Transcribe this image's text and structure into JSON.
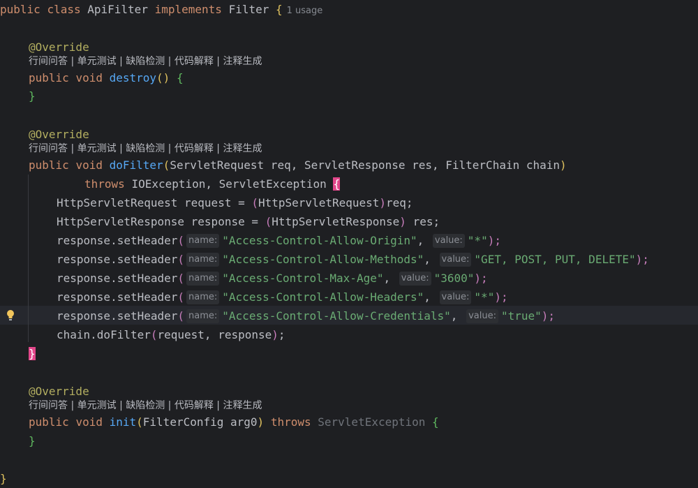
{
  "class_decl": {
    "kw1": "public",
    "kw2": "class",
    "name": "ApiFilter",
    "kw3": "implements",
    "iface": "Filter",
    "brace": "{",
    "usage": "1 usage"
  },
  "code_lens": "行间问答 | 单元测试 | 缺陷检测 | 代码解释 | 注释生成",
  "annotation": "@Override",
  "destroy": {
    "kw1": "public",
    "kw2": "void",
    "name": "destroy",
    "parens": "()",
    "open": "{",
    "close": "}"
  },
  "dofilter": {
    "kw1": "public",
    "kw2": "void",
    "name": "doFilter",
    "open_paren": "(",
    "params": "ServletRequest req, ServletResponse res, FilterChain chain",
    "close_paren": ")",
    "throws_kw": "throws",
    "exceptions": "IOException, ServletException",
    "open_brace": "{",
    "close_brace": "}"
  },
  "body": {
    "l1": {
      "type": "HttpServletRequest request = ",
      "lp": "(",
      "cast": "HttpServletRequest",
      "rp": ")",
      "rest": "req;"
    },
    "l2": {
      "type": "HttpServletResponse response = ",
      "lp": "(",
      "cast": "HttpServletResponse",
      "rp": ")",
      "rest": " res;"
    },
    "set_header_call": "response.setHeader",
    "name_hint": "name:",
    "value_hint": "value:",
    "headers": [
      {
        "name": "\"Access-Control-Allow-Origin\"",
        "value": "\"*\""
      },
      {
        "name": "\"Access-Control-Allow-Methods\"",
        "value": "\"GET, POST, PUT, DELETE\""
      },
      {
        "name": "\"Access-Control-Max-Age\"",
        "value": "\"3600\""
      },
      {
        "name": "\"Access-Control-Allow-Headers\"",
        "value": "\"*\""
      },
      {
        "name": "\"Access-Control-Allow-Credentials\"",
        "value": "\"true\""
      }
    ],
    "chain_call": "chain.doFilter",
    "chain_args": "request, response",
    "semicolon": ";"
  },
  "init": {
    "kw1": "public",
    "kw2": "void",
    "name": "init",
    "params": "FilterConfig arg0",
    "throws_kw": "throws",
    "exception": "ServletException",
    "open": "{",
    "close": "}"
  },
  "final_brace": "}",
  "punct": {
    "comma": ", ",
    "lp": "(",
    "rp": ")",
    "end": ");"
  }
}
